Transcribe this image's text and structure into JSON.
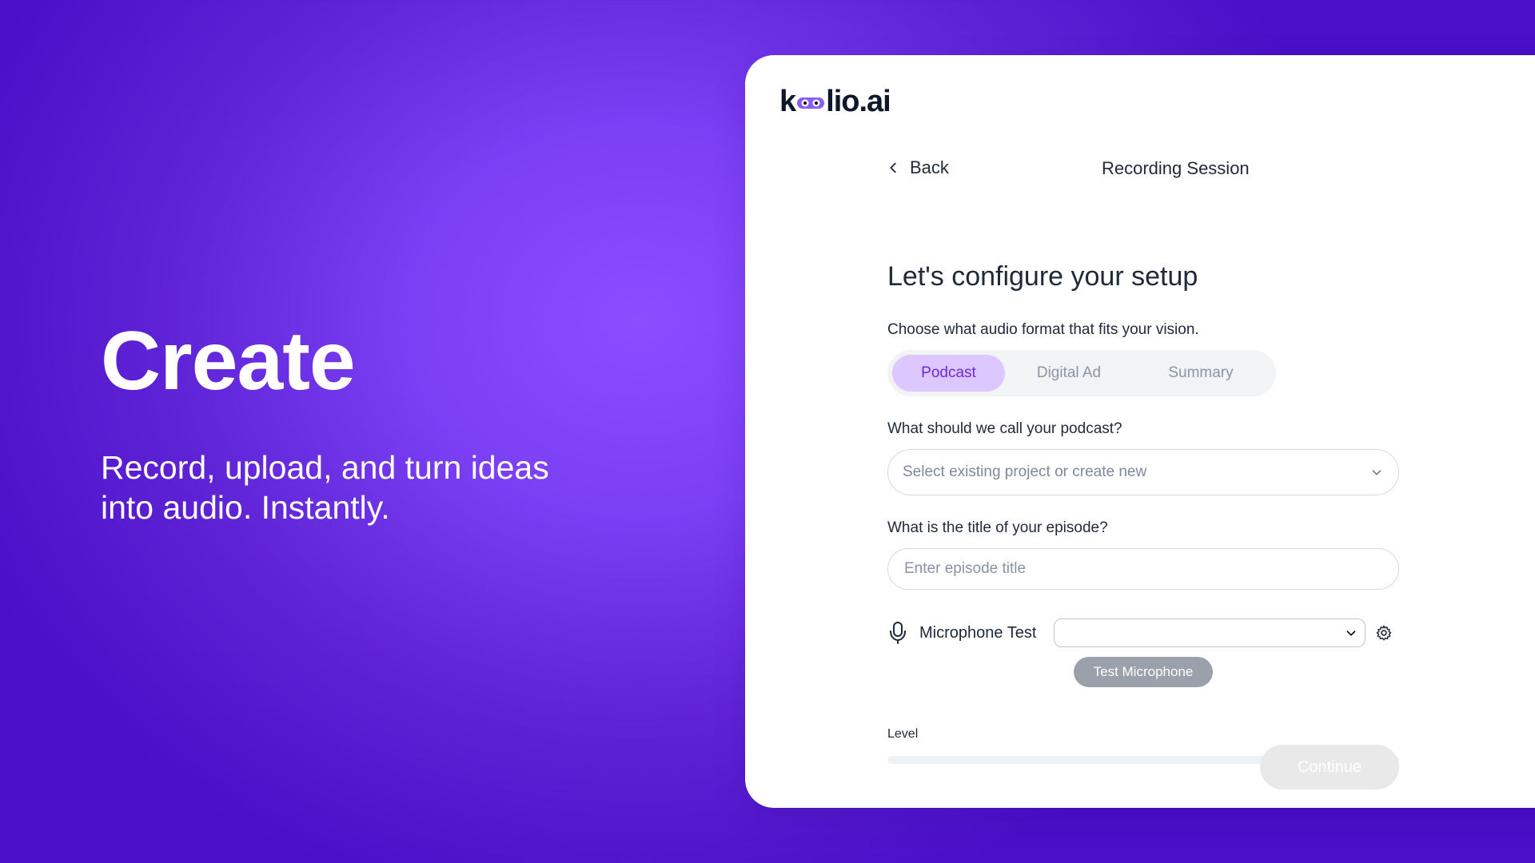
{
  "hero": {
    "title": "Create",
    "subtitle_line_1": "Record, upload, and turn ideas",
    "subtitle_line_2": "into audio. Instantly."
  },
  "brand": {
    "prefix": "k",
    "suffix": "lio.ai",
    "mark_icon": "infinity-loop-icon",
    "accent_color": "#8b5cf6"
  },
  "navigation": {
    "back_label": "Back",
    "back_icon": "chevron-left-icon",
    "session_title": "Recording Session"
  },
  "setup": {
    "heading": "Let's configure your setup",
    "format_prompt": "Choose what audio format that fits your vision.",
    "formats": [
      {
        "label": "Podcast",
        "selected": true
      },
      {
        "label": "Digital Ad",
        "selected": false
      },
      {
        "label": "Summary",
        "selected": false
      }
    ],
    "podcast_name_label": "What should we call your podcast?",
    "project_select_value": "Select existing project or create new",
    "project_select_icon": "chevron-down-icon",
    "episode_title_label": "What is the title of your episode?",
    "episode_title_placeholder": "Enter episode title",
    "episode_title_value": ""
  },
  "microphone": {
    "label": "Microphone Test",
    "icon": "microphone-icon",
    "selected_device": "",
    "dropdown_icon": "chevron-down-icon",
    "settings_icon": "gear-icon",
    "test_button_label": "Test Microphone",
    "level_label": "Level",
    "level_value": 0
  },
  "actions": {
    "continue_label": "Continue",
    "continue_enabled": false
  },
  "colors": {
    "background_primary": "#7b3ff4",
    "card_background": "#ffffff",
    "selected_segment": "#dcc7ff",
    "selected_text": "#6d28d9",
    "disabled_button": "#e9e9ea"
  }
}
